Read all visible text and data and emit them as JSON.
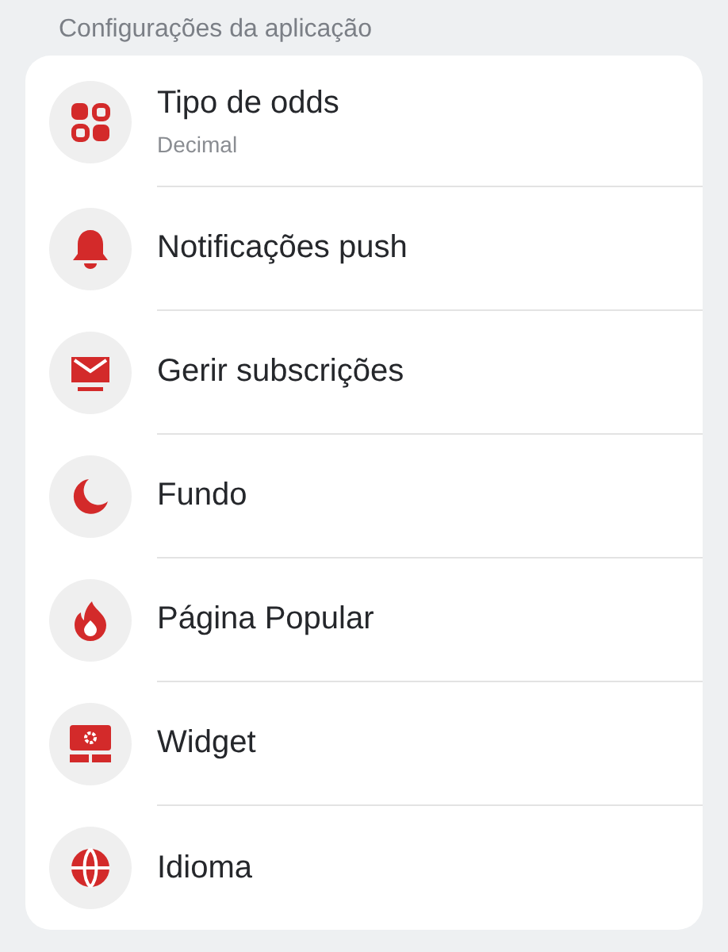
{
  "section": {
    "title": "Configurações da aplicação"
  },
  "items": [
    {
      "label": "Tipo de odds",
      "value": "Decimal"
    },
    {
      "label": "Notificações push"
    },
    {
      "label": "Gerir subscrições"
    },
    {
      "label": "Fundo"
    },
    {
      "label": "Página Popular"
    },
    {
      "label": "Widget"
    },
    {
      "label": "Idioma"
    }
  ]
}
